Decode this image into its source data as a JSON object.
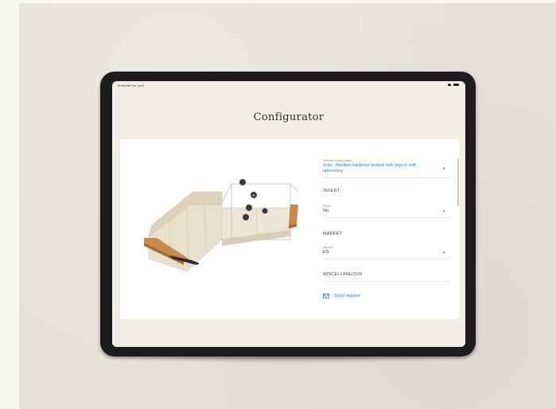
{
  "status_bar": {
    "time": "10:45 AM  Tue Jul 5"
  },
  "page": {
    "title": "Configurator"
  },
  "panel": {
    "selected_component_label": "Selected component",
    "selected_component_value": "Sofa - Medium backrest module with legs in soft upholstery",
    "sections": [
      {
        "title": "INSERT",
        "field_label": "Pillow",
        "field_value": "No"
      },
      {
        "title": "MARKET",
        "field_label": "Market",
        "field_value": "ES"
      },
      {
        "title": "MISCELLANEOUS"
      }
    ],
    "send_request": "Send request"
  },
  "viewer": {
    "hotspot_icons": [
      "dot-marker-icon",
      "plus-icon",
      "rotate-icon",
      "remove-icon",
      "info-icon"
    ]
  },
  "colors": {
    "accent": "#2a7bd4",
    "fabric": "#e8dfcd",
    "wood": "#c9894a",
    "frame": "#1d1d1f"
  }
}
